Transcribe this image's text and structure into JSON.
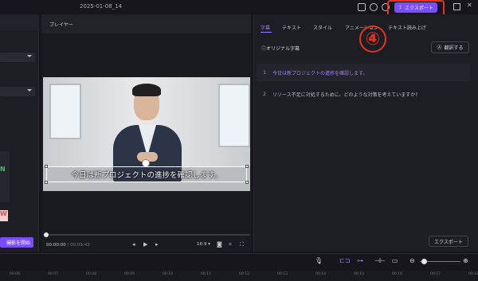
{
  "app": {
    "date_title": "2025-01-08_14",
    "export_label": "エクスポート",
    "step_marker": "④"
  },
  "left": {
    "start_label": "撮影を開始",
    "thumb_letters": [
      "N",
      "W"
    ]
  },
  "player": {
    "title": "プレイヤー",
    "subtitle_text": "今日は新プロジェクトの進捗を確認します。",
    "time_current": "00:00:00",
    "time_total": "00:09:43",
    "aspect": "16:9"
  },
  "right": {
    "tabs": [
      "字幕",
      "テキスト",
      "スタイル",
      "アニメーション",
      "テキスト読み上げ"
    ],
    "active_tab": "字幕",
    "original_label": "オリジナル字幕",
    "translate_label": "翻訳する",
    "subtitles": [
      {
        "num": "1",
        "text": "今日は新プロジェクトの進捗を確認します。"
      },
      {
        "num": "2",
        "text": "リソース不足に対処するために、どのような対策を考えていますか?"
      }
    ],
    "export_label": "エクスポート"
  },
  "timeline": {
    "ticks": [
      "00:06",
      "00:07",
      "00:08",
      "00:09",
      "00:10",
      "00:11",
      "00:12",
      "00:13",
      "00:14",
      "00:15",
      "00:16",
      "00:17",
      "00:18"
    ]
  },
  "colors": {
    "accent": "#7a4dff",
    "accent_text": "#a47bff",
    "annotation": "#e8321c"
  }
}
